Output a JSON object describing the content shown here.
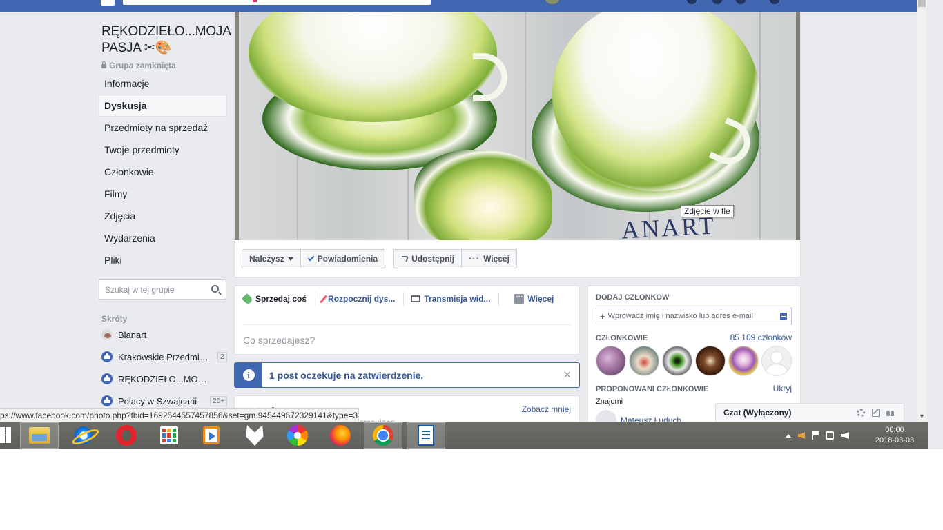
{
  "group": {
    "title": "RĘKODZIEŁO...MOJA PASJA ✂🎨",
    "privacy": "Grupa zamknięta"
  },
  "nav": [
    "Informacje",
    "Dyskusja",
    "Przedmioty na sprzedaż",
    "Twoje przedmioty",
    "Członkowie",
    "Filmy",
    "Zdjęcia",
    "Wydarzenia",
    "Pliki"
  ],
  "nav_active": "Dyskusja",
  "group_search": {
    "placeholder": "Szukaj w tej grupie"
  },
  "shortcuts": {
    "heading": "Skróty",
    "items": [
      {
        "label": "Blanart",
        "icon": "page-avatar-icon",
        "badge": ""
      },
      {
        "label": "Krakowskie Przedmioty",
        "icon": "group-icon",
        "badge": "2"
      },
      {
        "label": "RĘKODZIEŁO...MOJA PASJA",
        "icon": "group-icon",
        "badge": ""
      },
      {
        "label": "Polacy w Szwajcarii",
        "icon": "group-icon",
        "badge": "20+"
      }
    ]
  },
  "cover": {
    "watermark": "ANART",
    "tooltip": "Zdjęcie w tle"
  },
  "cover_actions": {
    "member": "Należysz",
    "notifications": "Powiadomienia",
    "share": "Udostępnij",
    "more": "Więcej"
  },
  "composer": {
    "tabs": [
      "Sprzedaj coś",
      "Rozpocznij dys...",
      "Transmisja wid..."
    ],
    "more": "Więcej",
    "prompt": "Co sprzedajesz?"
  },
  "pending": {
    "text": "1 post oczekuje na zatwierdzenie."
  },
  "suggested": {
    "title": "...atorów",
    "link": "Zobacz mniej",
    "subtitle": "...grupy mogą być dla Ciebie interesujące"
  },
  "right": {
    "add_members": "DODAJ CZŁONKÓW",
    "add_placeholder": "Wprowadź imię i nazwisko lub adres e-mail",
    "members_heading": "CZŁONKOWIE",
    "members_count": "85 109 członków",
    "proposed": "PROPONOWANI CZŁONKOWIE",
    "hide": "Ukryj",
    "friends": "Znajomi",
    "friend_name": "Mateusz Łuduch"
  },
  "chat": {
    "label": "Czat (Wyłączony)"
  },
  "statusbar": "ps://www.facebook.com/photo.php?fbid=1692544557457856&set=gm.945449672329141&type=3",
  "clock": {
    "time": "00:00",
    "date": "2018-03-03"
  },
  "colors": {
    "brand": "#4267b2",
    "link": "#365899"
  }
}
